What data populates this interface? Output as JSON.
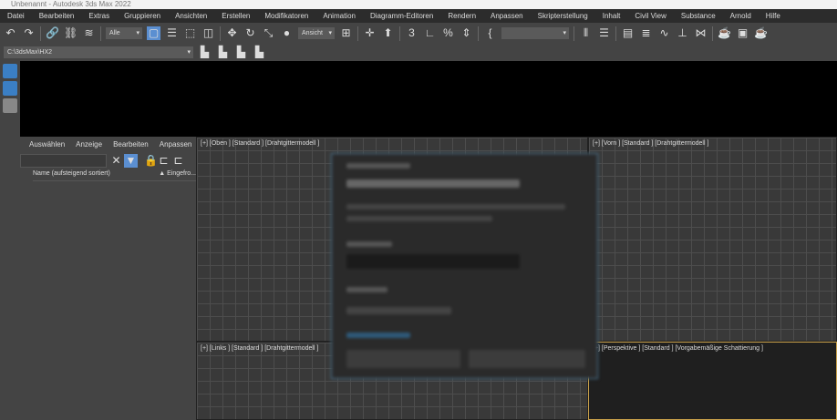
{
  "window": {
    "title": "Unbenannt - Autodesk 3ds Max 2022"
  },
  "menu": [
    "Datei",
    "Bearbeiten",
    "Extras",
    "Gruppieren",
    "Ansichten",
    "Erstellen",
    "Modifikatoren",
    "Animation",
    "Diagramm-Editoren",
    "Rendern",
    "Anpassen",
    "Skripterstellung",
    "Inhalt",
    "Civil View",
    "Substance",
    "Arnold",
    "Hilfe"
  ],
  "toolbar": {
    "selection_filter": "Alle",
    "reference_coord": "Ansicht",
    "named_selection": ""
  },
  "project_path": "C:\\3dsMax\\HX2",
  "scene_explorer": {
    "menu": [
      "Auswählen",
      "Anzeige",
      "Bearbeiten",
      "Anpassen"
    ],
    "col_name": "Name (aufsteigend sortiert)",
    "col_frozen": "▲ Eingefro..."
  },
  "viewports": {
    "top": "[+] [Oben ] [Standard ] [Drahtgittermodell ]",
    "front": "[+] [Vorn ] [Standard ] [Drahtgittermodell ]",
    "left": "[+] [Links ] [Standard ] [Drahtgittermodell ]",
    "persp": "[+] [Perspektive ] [Standard ] [Vorgabemäßige Schattierung ]"
  }
}
